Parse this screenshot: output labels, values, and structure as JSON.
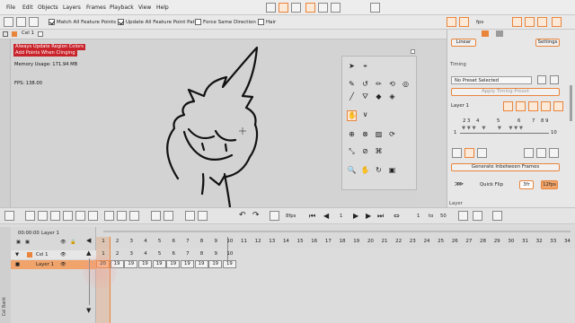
{
  "menu": {
    "items": [
      "File",
      "Edit",
      "Objects",
      "Layers",
      "Frames",
      "Playback",
      "View",
      "Help"
    ]
  },
  "toolbar": {
    "match_all": "Match All Feature Points",
    "update_all_paths": "Update All Feature Point Paths",
    "force_same": "Force Same Direction",
    "hair": "Hair"
  },
  "layerbar": {
    "cel": "Cel 1"
  },
  "canvas": {
    "msg1": "Always Update Region Colors",
    "msg2": "Add Points When Clinging",
    "memory": "Memory Usage: 171.94 MB",
    "fps": "FPS: 138.00"
  },
  "right": {
    "fps_label": "fps",
    "linear": "Linear",
    "settings": "Settings",
    "timing_header": "Timing",
    "preset": "No Preset Selected",
    "apply": "Apply Timing Preset",
    "layer_label": "Layer 1",
    "tick_top": [
      "2",
      "3",
      "4",
      "5",
      "6",
      "7",
      "8",
      "9"
    ],
    "tick_first": "1",
    "tick_last": "10",
    "generate": "Generate Inbetween Frames",
    "quick_flip": "Quick Flip",
    "qf_val1": "3fr",
    "qf_val2": "12fps",
    "layer_tab": "Layer"
  },
  "playbar": {
    "fps": "8fps",
    "frame": "1",
    "from": "1",
    "to_label": "to",
    "to": "50"
  },
  "timeline": {
    "time": "00:00:00",
    "top_layer": "Layer 1",
    "row1": "Cel 1",
    "row2": "Layer 1",
    "side_tab": "Cel Bank",
    "frames": [
      "1",
      "2",
      "3",
      "4",
      "5",
      "6",
      "7",
      "8",
      "9",
      "10",
      "11",
      "12",
      "13",
      "14",
      "15",
      "16",
      "17",
      "18",
      "19",
      "20",
      "21",
      "22",
      "23",
      "24",
      "25",
      "26",
      "27",
      "28",
      "29",
      "30",
      "31",
      "32",
      "33",
      "34"
    ],
    "cel_row": [
      "1",
      "2",
      "3",
      "4",
      "5",
      "6",
      "7",
      "8",
      "9",
      "10"
    ],
    "layer_row": [
      "20",
      "19",
      "19",
      "19",
      "19",
      "19",
      "19",
      "19",
      "19",
      "19"
    ]
  },
  "colors": {
    "accent": "#e9843b",
    "alert": "#c9232b",
    "canvas": "#d3d3d3"
  }
}
